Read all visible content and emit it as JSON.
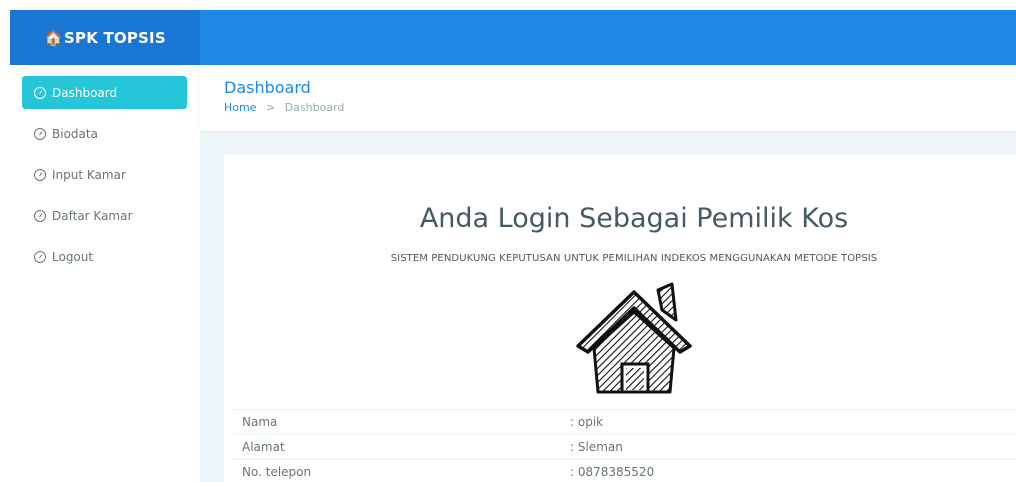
{
  "brand": {
    "house_glyph": "🏠",
    "title": "SPK TOPSIS"
  },
  "sidebar": {
    "items": [
      {
        "label": "Dashboard",
        "active": true,
        "icon": "dashboard-gauge-icon"
      },
      {
        "label": "Biodata",
        "active": false,
        "icon": "dashboard-gauge-icon"
      },
      {
        "label": "Input Kamar",
        "active": false,
        "icon": "dashboard-gauge-icon"
      },
      {
        "label": "Daftar Kamar",
        "active": false,
        "icon": "dashboard-gauge-icon"
      },
      {
        "label": "Logout",
        "active": false,
        "icon": "dashboard-gauge-icon"
      }
    ]
  },
  "header": {
    "title": "Dashboard",
    "breadcrumb": {
      "home": "Home",
      "separator": ">",
      "current": "Dashboard"
    }
  },
  "main": {
    "title": "Anda Login Sebagai Pemilik Kos",
    "subtitle": "SISTEM PENDUKUNG KEPUTUSAN UNTUK PEMILIHAN INDEKOS MENGGUNAKAN METODE TOPSIS",
    "image_icon": "house-sketch-icon",
    "info": [
      {
        "label": "Nama",
        "value": ": opik"
      },
      {
        "label": "Alamat",
        "value": ": Sleman"
      },
      {
        "label": "No. telepon",
        "value": ": 0878385520"
      }
    ]
  },
  "colors": {
    "topbar": "#1e88e5",
    "brand_bg": "#1976d2",
    "active_nav": "#26c6da",
    "content_bg": "#eef5f9",
    "title_blue": "#1e88e5"
  }
}
